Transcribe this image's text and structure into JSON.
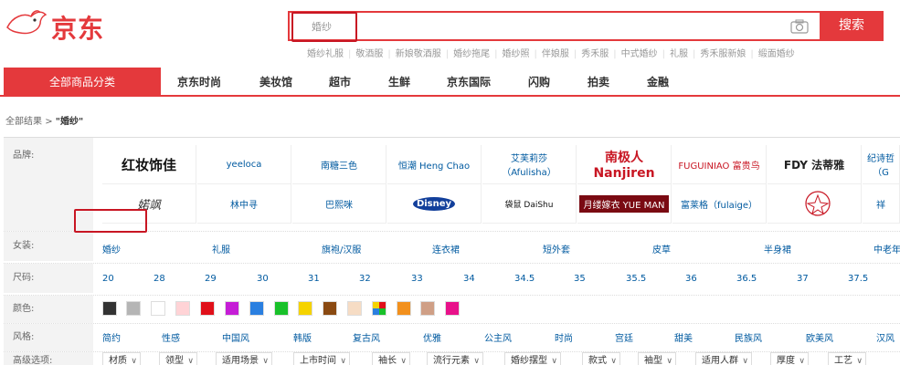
{
  "header": {
    "brand": "京东",
    "search_value": "婚纱",
    "search_button": "搜索",
    "hotwords": [
      "婚纱礼服",
      "敬酒服",
      "新娘敬酒服",
      "婚纱拖尾",
      "婚纱照",
      "伴娘服",
      "秀禾服",
      "中式婚纱",
      "礼服",
      "秀禾服新娘",
      "缎面婚纱"
    ]
  },
  "nav": {
    "all": "全部商品分类",
    "items": [
      "京东时尚",
      "美妆馆",
      "超市",
      "生鲜",
      "京东国际",
      "闪购",
      "拍卖",
      "金融"
    ]
  },
  "breadcrumb": {
    "root": "全部结果",
    "sep": ">",
    "query": "\"婚纱\""
  },
  "filters": {
    "brand_label": "品牌:",
    "brands_row1": [
      "红妆饰佳",
      "yeeloca",
      "南糖三色",
      "恒潮 Heng Chao",
      "艾芙莉莎（Afulisha）",
      "南极人 Nanjiren",
      "FUGUINIAO 富贵鸟",
      "FDY 法蒂雅",
      "纪诗哲（G"
    ],
    "brands_row2": [
      "婼飒",
      "林中寻",
      "巴熙咪",
      "Disney",
      "袋鼠 DaiShu",
      "月缕嫁衣 YUE MAN",
      "富莱格（fulaige）",
      "",
      "祥"
    ],
    "women_label": "女装:",
    "women": [
      "婚纱",
      "礼服",
      "旗袍/汉服",
      "连衣裙",
      "短外套",
      "皮草",
      "半身裙",
      "中老年"
    ],
    "size_label": "尺码:",
    "sizes": [
      "20",
      "28",
      "29",
      "30",
      "31",
      "32",
      "33",
      "34",
      "34.5",
      "35",
      "35.5",
      "36",
      "36.5",
      "37",
      "37.5"
    ],
    "color_label": "颜色:",
    "colors": [
      "#333333",
      "#b5b5b5",
      "#ffffff",
      "#ffd3d6",
      "#e0101a",
      "#c51dd6",
      "#2a7fe0",
      "#19c12a",
      "#f5d300",
      "#8a4a12",
      "#f6dcc4",
      "multi",
      "#f2901d",
      "#cf9f86",
      "#e8118a"
    ],
    "style_label": "风格:",
    "styles": [
      "简约",
      "性感",
      "中国风",
      "韩版",
      "复古风",
      "优雅",
      "公主风",
      "时尚",
      "宫廷",
      "甜美",
      "民族风",
      "欧美风",
      "汉风"
    ],
    "adv_label": "高级选项:",
    "adv": [
      "材质",
      "领型",
      "适用场景",
      "上市时间",
      "袖长",
      "流行元素",
      "婚纱摆型",
      "款式",
      "袖型",
      "适用人群",
      "厚度",
      "工艺"
    ]
  }
}
